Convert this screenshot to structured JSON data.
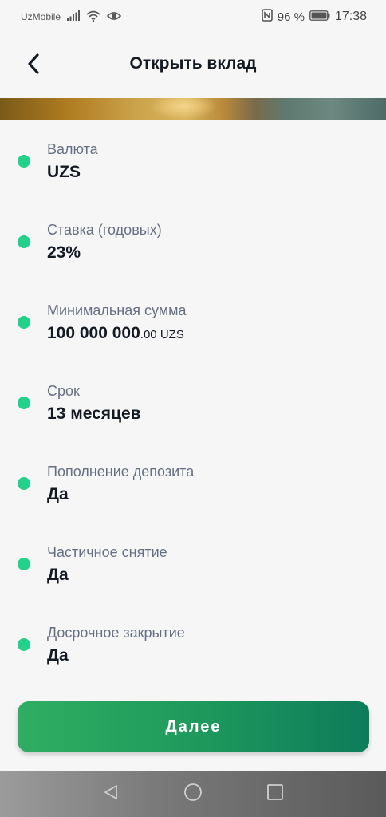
{
  "status_bar": {
    "carrier": "UzMobile",
    "battery": "96 %",
    "time": "17:38",
    "icons": [
      "signal-icon",
      "wifi-icon",
      "eye-icon",
      "nfc-icon",
      "battery-icon"
    ]
  },
  "header": {
    "title": "Открыть вклад",
    "back_icon": "chevron-left-icon"
  },
  "details": {
    "items": [
      {
        "label": "Валюта",
        "value": "UZS"
      },
      {
        "label": "Ставка (годовых)",
        "value": "23%"
      },
      {
        "label": "Минимальная сумма",
        "value_main": "100 000 000",
        "value_frac": ".00",
        "value_currency": " UZS"
      },
      {
        "label": "Срок",
        "value": "13 месяцев"
      },
      {
        "label": "Пополнение депозита",
        "value": "Да"
      },
      {
        "label": "Частичное снятие",
        "value": "Да"
      },
      {
        "label": "Досрочное закрытие",
        "value": "Да"
      }
    ]
  },
  "actions": {
    "next_label": "Далее"
  },
  "colors": {
    "accent_dot": "#23d18b",
    "button_start": "#2fae62",
    "button_end": "#0d7c5b",
    "title_text": "#141a24",
    "label_text": "#667085"
  },
  "nav": {
    "buttons": [
      "back-triangle-icon",
      "home-circle-icon",
      "recents-square-icon"
    ]
  }
}
